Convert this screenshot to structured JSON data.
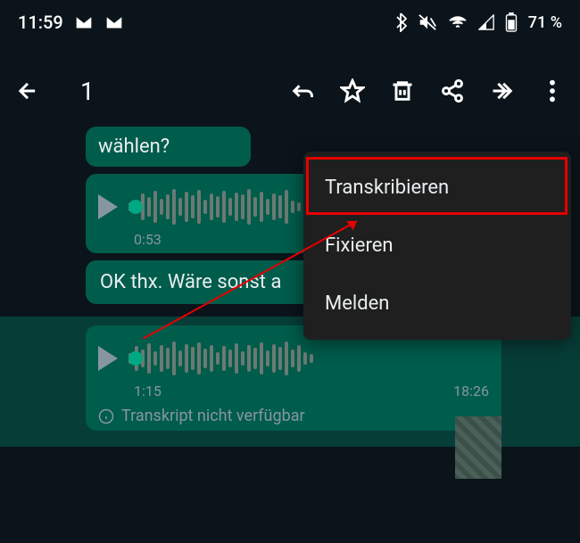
{
  "status": {
    "time": "11:59",
    "battery": "71 %"
  },
  "actionbar": {
    "count": "1"
  },
  "messages": {
    "waehlen": "wählen?",
    "voice1_duration": "0:53",
    "oktext": "OK thx. Wäre sonst a",
    "voice2_duration": "1:15",
    "voice2_time": "18:26",
    "transcript_unavailable": "Transkript nicht verfügbar"
  },
  "menu": {
    "transcribe": "Transkribieren",
    "pin": "Fixieren",
    "report": "Melden"
  }
}
